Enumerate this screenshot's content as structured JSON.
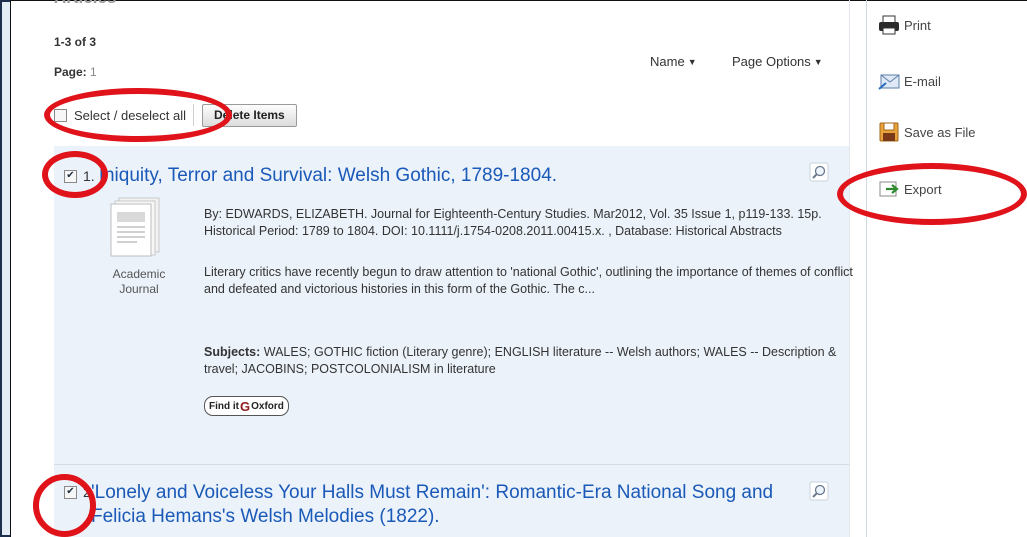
{
  "results": {
    "section_title": "Articles",
    "count": "1-3 of 3",
    "page_label": "Page:",
    "page_number": "1",
    "sort_label": "Name",
    "page_options_label": "Page Options",
    "select_all_label": "Select / deselect all",
    "delete_label": "Delete Items"
  },
  "items": [
    {
      "number": "1.",
      "title": "Iniquity, Terror and Survival: Welsh Gothic, 1789-1804.",
      "checked": true,
      "citation": "By: EDWARDS, ELIZABETH. Journal for Eighteenth-Century Studies. Mar2012, Vol. 35 Issue 1, p119-133. 15p. Historical Period: 1789 to 1804. DOI: 10.1111/j.1754-0208.2011.00415.x. , Database: Historical Abstracts",
      "doc_type_line1": "Academic",
      "doc_type_line2": "Journal",
      "abstract": "Literary critics have recently begun to draw attention to 'national Gothic', outlining the importance of themes of conflict and defeated and victorious histories in this form of the Gothic. The c...",
      "subjects_label": "Subjects:",
      "subjects": " WALES; GOTHIC fiction (Literary genre); ENGLISH literature -- Welsh authors; WALES -- Description & travel; JACOBINS; POSTCOLONIALISM in literature",
      "findit_prefix": "Find it",
      "findit_logo": "G",
      "findit_suffix": "Oxford"
    },
    {
      "number": "2.",
      "title": "'Lonely and Voiceless Your Halls Must Remain': Romantic-Era National Song and Felicia Hemans's Welsh Melodies (1822).",
      "checked": true
    }
  ],
  "tools": {
    "print": "Print",
    "email": "E-mail",
    "save": "Save as File",
    "export": "Export"
  },
  "colors": {
    "link": "#1a59b8",
    "highlight_ring": "#e0121a",
    "result_bg": "#ebf2fa"
  }
}
